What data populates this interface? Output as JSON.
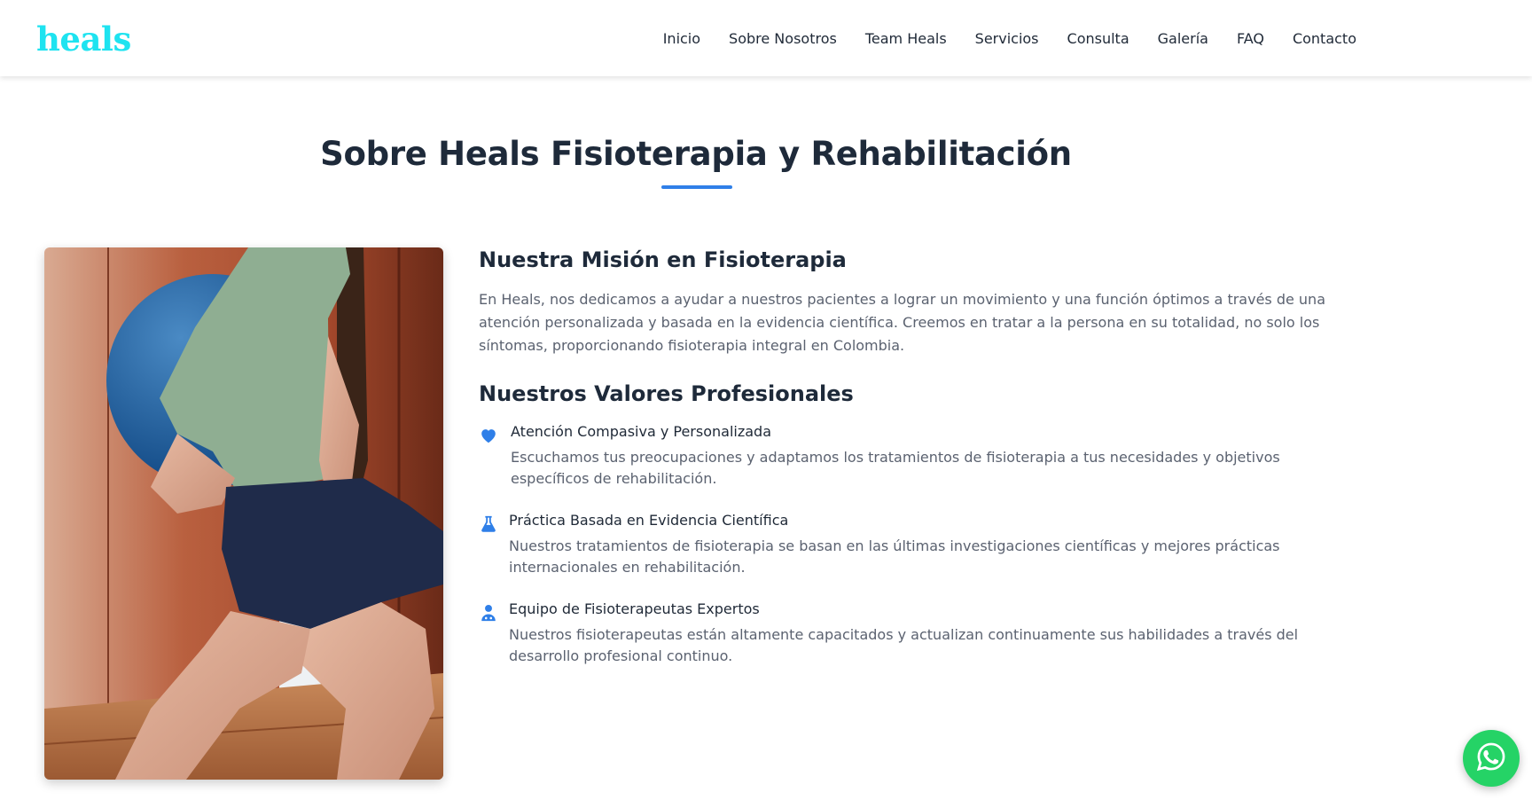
{
  "brand": {
    "logo": "heals",
    "logo_color": "#1ee3f0"
  },
  "nav": {
    "items": [
      {
        "label": "Inicio"
      },
      {
        "label": "Sobre Nosotros"
      },
      {
        "label": "Team Heals"
      },
      {
        "label": "Servicios"
      },
      {
        "label": "Consulta"
      },
      {
        "label": "Galería"
      },
      {
        "label": "FAQ"
      },
      {
        "label": "Contacto"
      }
    ]
  },
  "about": {
    "title": "Sobre Heals Fisioterapia y Rehabilitación",
    "accent_color": "#2f7fe8",
    "image": {
      "icon": "physiotherapy-photo"
    },
    "mission": {
      "heading": "Nuestra Misión en Fisioterapia",
      "text": "En Heals, nos dedicamos a ayudar a nuestros pacientes a lograr un movimiento y una función óptimos a través de una atención personalizada y basada en la evidencia científica. Creemos en tratar a la persona en su totalidad, no solo los síntomas, proporcionando fisioterapia integral en Colombia."
    },
    "values": {
      "heading": "Nuestros Valores Profesionales",
      "items": [
        {
          "icon": "heart-icon",
          "title": "Atención Compasiva y Personalizada",
          "desc": "Escuchamos tus preocupaciones y adaptamos los tratamientos de fisioterapia a tus necesidades y objetivos específicos de rehabilitación."
        },
        {
          "icon": "flask-icon",
          "title": "Práctica Basada en Evidencia Científica",
          "desc": "Nuestros tratamientos de fisioterapia se basan en las últimas investigaciones científicas y mejores prácticas internacionales en rehabilitación."
        },
        {
          "icon": "doctor-icon",
          "title": "Equipo de Fisioterapeutas Expertos",
          "desc": "Nuestros fisioterapeutas están altamente capacitados y actualizan continuamente sus habilidades a través del desarrollo profesional continuo."
        }
      ]
    }
  },
  "whatsapp": {
    "icon": "whatsapp-icon",
    "color": "#25d366"
  }
}
